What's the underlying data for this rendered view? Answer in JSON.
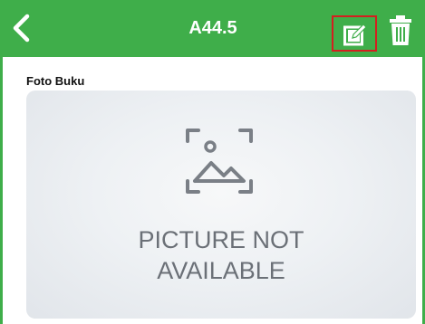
{
  "header": {
    "title": "A44.5",
    "back_icon": "chevron-left-icon",
    "edit_icon": "edit-icon",
    "delete_icon": "trash-icon",
    "bar_color": "#3fae4a",
    "highlight_color": "#d41f1f"
  },
  "content": {
    "section_label": "Foto Buku",
    "placeholder_icon": "image-placeholder-icon",
    "placeholder_line1": "PICTURE NOT",
    "placeholder_line2": "AVAILABLE"
  }
}
